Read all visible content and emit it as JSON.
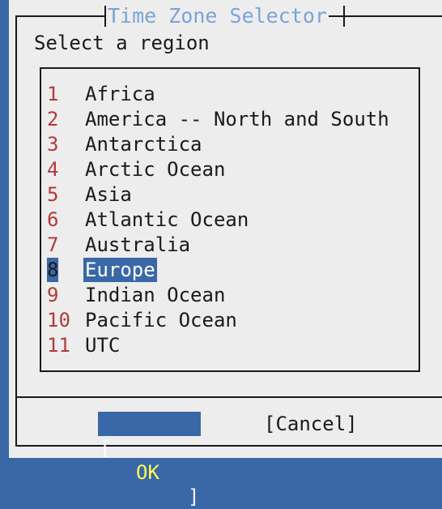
{
  "dialog": {
    "title": "Time Zone Selector",
    "prompt": "Select a region"
  },
  "regions": [
    {
      "number": "1",
      "label": "Africa"
    },
    {
      "number": "2",
      "label": "America -- North and South"
    },
    {
      "number": "3",
      "label": "Antarctica"
    },
    {
      "number": "4",
      "label": "Arctic Ocean"
    },
    {
      "number": "5",
      "label": "Asia"
    },
    {
      "number": "6",
      "label": "Atlantic Ocean"
    },
    {
      "number": "7",
      "label": "Australia"
    },
    {
      "number": "8",
      "label": "Europe",
      "selected": true
    },
    {
      "number": "9",
      "label": "Indian Ocean"
    },
    {
      "number": "10",
      "label": "Pacific Ocean"
    },
    {
      "number": "11",
      "label": "UTC"
    }
  ],
  "buttons": {
    "ok_open": "[",
    "ok_label": "OK",
    "ok_close": "]",
    "cancel_label": "[Cancel]"
  },
  "colors": {
    "background": "#3a68a6",
    "dialog": "#ededed",
    "title": "#7aa4d8",
    "number": "#b23a3a",
    "highlight": "#3a68a6",
    "ok_text": "#ffff54"
  }
}
